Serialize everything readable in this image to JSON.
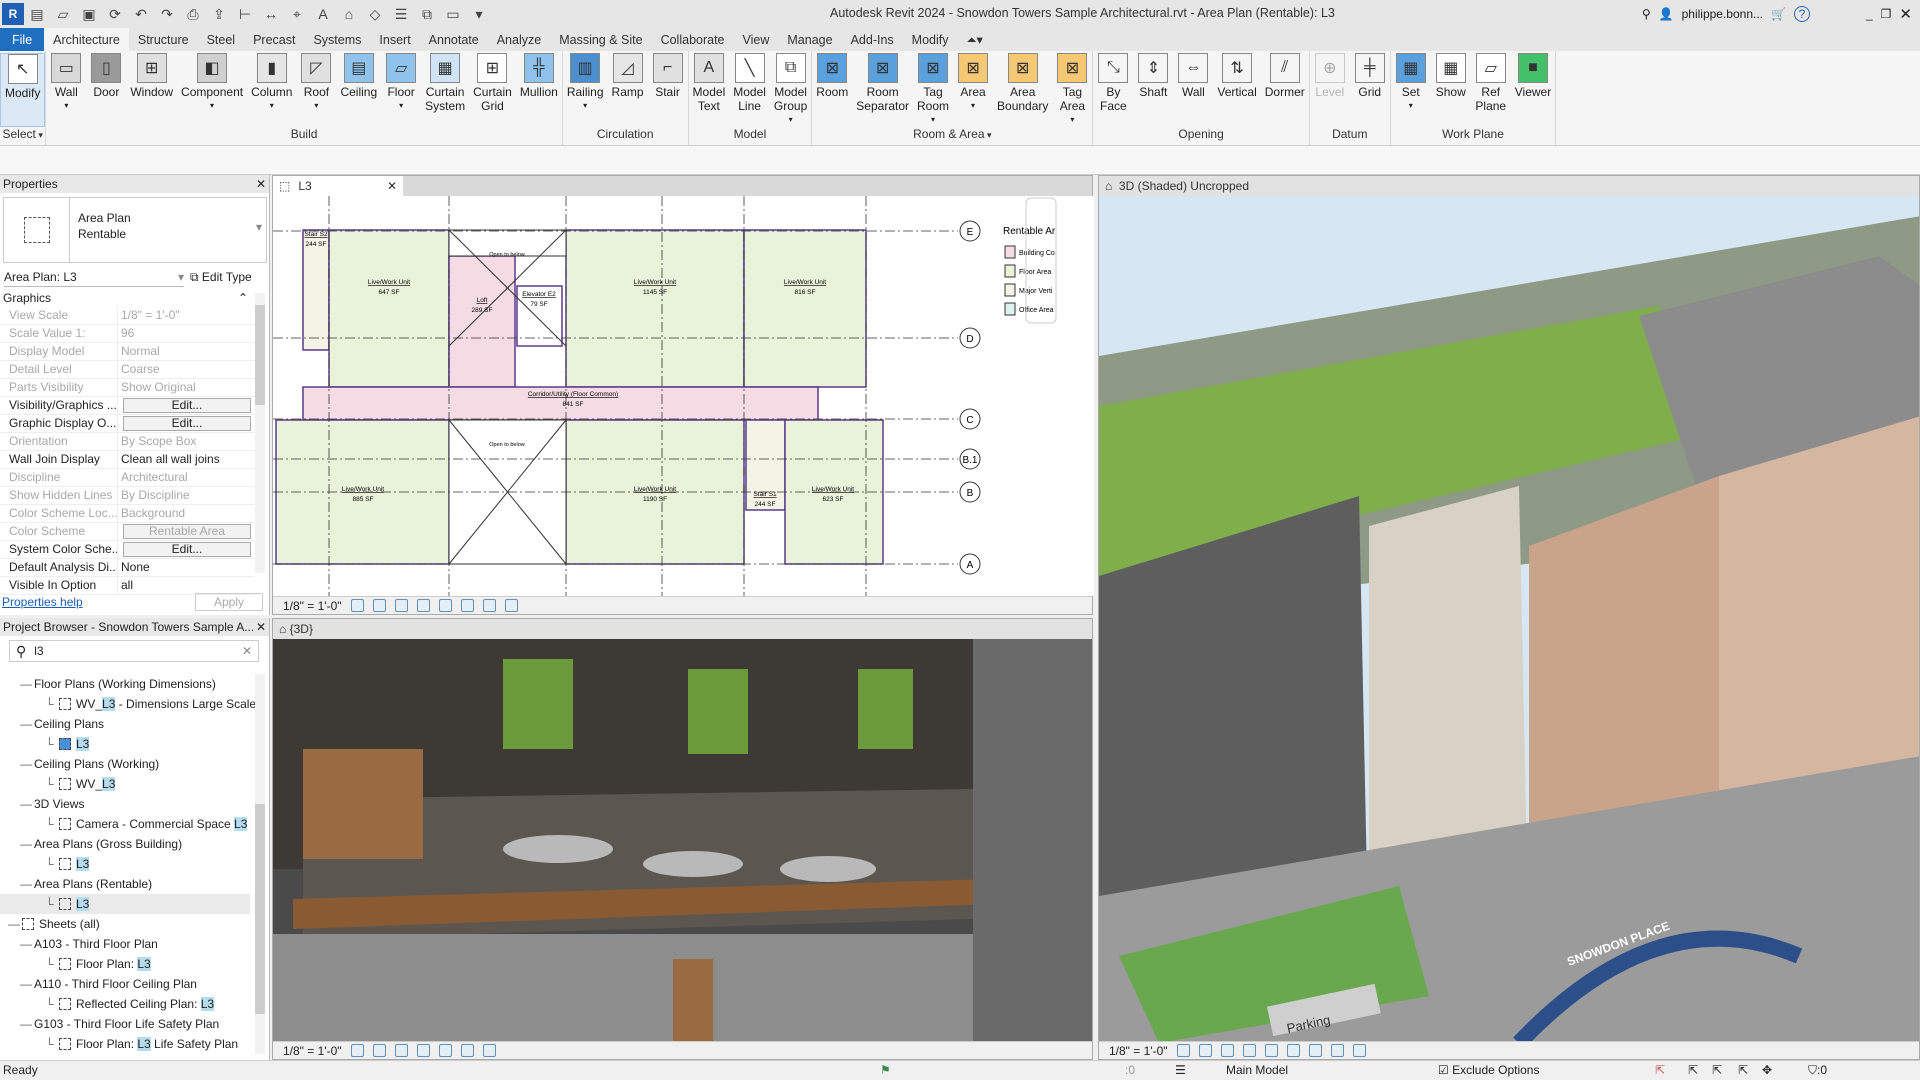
{
  "titlebar": {
    "app_icon": "R",
    "title": "Autodesk Revit 2024 - Snowdon Towers Sample Architectural.rvt - Area Plan (Rentable): L3",
    "user": "philippe.bonn...",
    "quick_access": [
      "app-menu-icon",
      "open-icon",
      "save-icon",
      "sync-icon",
      "undo-icon",
      "redo-icon",
      "print-icon",
      "export-icon",
      "measure-icon",
      "dimension-icon",
      "tag-icon",
      "text-icon",
      "home-3d-icon",
      "section-icon",
      "thin-lines-icon",
      "close-hidden-icon",
      "switch-windows-icon",
      "customize-icon"
    ]
  },
  "tabs": [
    "File",
    "Architecture",
    "Structure",
    "Steel",
    "Precast",
    "Systems",
    "Insert",
    "Annotate",
    "Analyze",
    "Massing & Site",
    "Collaborate",
    "View",
    "Manage",
    "Add-Ins",
    "Modify"
  ],
  "active_tab": "Architecture",
  "ribbon": {
    "panels": [
      {
        "label": "Select",
        "dropdown": true,
        "buttons": [
          {
            "label": "Modify",
            "icon": "cursor-icon",
            "glyph": "↖",
            "color": "#ffffff",
            "selected": true
          }
        ]
      },
      {
        "label": "Build",
        "buttons": [
          {
            "label": "Wall",
            "icon": "wall-icon",
            "glyph": "▭",
            "color": "#d8d8d8",
            "dropdown": true
          },
          {
            "label": "Door",
            "icon": "door-icon",
            "glyph": "▯",
            "color": "#9a9a9a"
          },
          {
            "label": "Window",
            "icon": "window-icon",
            "glyph": "⊞",
            "color": "#e0e0e0"
          },
          {
            "label": "Component",
            "icon": "component-icon",
            "glyph": "◧",
            "color": "#d0d0d0",
            "dropdown": true
          },
          {
            "label": "Column",
            "icon": "column-icon",
            "glyph": "▮",
            "color": "#e6e6e6",
            "dropdown": true
          },
          {
            "label": "Roof",
            "icon": "roof-icon",
            "glyph": "◸",
            "color": "#e0e0e0",
            "dropdown": true
          },
          {
            "label": "Ceiling",
            "icon": "ceiling-icon",
            "glyph": "▤",
            "color": "#8fc3ee"
          },
          {
            "label": "Floor",
            "icon": "floor-icon",
            "glyph": "▱",
            "color": "#8fc3ee",
            "dropdown": true
          },
          {
            "label": "Curtain",
            "label2": "System",
            "icon": "curtain-system-icon",
            "glyph": "▦",
            "color": "#cfe4f6"
          },
          {
            "label": "Curtain",
            "label2": "Grid",
            "icon": "curtain-grid-icon",
            "glyph": "⊞",
            "color": "#ffffff"
          },
          {
            "label": "Mullion",
            "icon": "mullion-icon",
            "glyph": "╬",
            "color": "#8fc3ee"
          }
        ]
      },
      {
        "label": "Circulation",
        "buttons": [
          {
            "label": "Railing",
            "icon": "railing-icon",
            "glyph": "▥",
            "color": "#4b8fd1",
            "dropdown": true
          },
          {
            "label": "Ramp",
            "icon": "ramp-icon",
            "glyph": "◿",
            "color": "#e6e6e6"
          },
          {
            "label": "Stair",
            "icon": "stair-icon",
            "glyph": "⌐",
            "color": "#e0e0e0"
          }
        ]
      },
      {
        "label": "Model",
        "buttons": [
          {
            "label": "Model",
            "label2": "Text",
            "icon": "model-text-icon",
            "glyph": "A",
            "color": "#e0e0e0"
          },
          {
            "label": "Model",
            "label2": "Line",
            "icon": "model-line-icon",
            "glyph": "╲",
            "color": "#ffffff"
          },
          {
            "label": "Model",
            "label2": "Group",
            "icon": "model-group-icon",
            "glyph": "⧉",
            "color": "#ffffff",
            "dropdown": true
          }
        ]
      },
      {
        "label": "Room & Area",
        "dropdown": true,
        "buttons": [
          {
            "label": "Room",
            "icon": "room-icon",
            "glyph": "⊠",
            "color": "#5aa0dc"
          },
          {
            "label": "Room",
            "label2": "Separator",
            "icon": "room-separator-icon",
            "glyph": "⊠",
            "color": "#5aa0dc"
          },
          {
            "label": "Tag",
            "label2": "Room",
            "icon": "tag-room-icon",
            "glyph": "⊠",
            "color": "#5aa0dc",
            "dropdown": true
          },
          {
            "label": "Area",
            "icon": "area-icon",
            "glyph": "⊠",
            "color": "#f7c873",
            "dropdown": true
          },
          {
            "label": "Area",
            "label2": "Boundary",
            "icon": "area-boundary-icon",
            "glyph": "⊠",
            "color": "#f7c873"
          },
          {
            "label": "Tag",
            "label2": "Area",
            "icon": "tag-area-icon",
            "glyph": "⊠",
            "color": "#f7c873",
            "dropdown": true
          }
        ]
      },
      {
        "label": "Opening",
        "buttons": [
          {
            "label": "By",
            "label2": "Face",
            "icon": "opening-by-face-icon",
            "glyph": "⤡",
            "color": "#f5f5f5"
          },
          {
            "label": "Shaft",
            "icon": "shaft-icon",
            "glyph": "⇕",
            "color": "#f5f5f5"
          },
          {
            "label": "Wall",
            "icon": "wall-opening-icon",
            "glyph": "⇔",
            "color": "#f5f5f5"
          },
          {
            "label": "Vertical",
            "icon": "vertical-opening-icon",
            "glyph": "⇅",
            "color": "#f5f5f5"
          },
          {
            "label": "Dormer",
            "icon": "dormer-icon",
            "glyph": "⫽",
            "color": "#f5f5f5"
          }
        ]
      },
      {
        "label": "Datum",
        "buttons": [
          {
            "label": "Level",
            "icon": "level-icon",
            "glyph": "⊕",
            "color": "#f5f5f5",
            "disabled": true
          },
          {
            "label": "Grid",
            "icon": "grid-icon",
            "glyph": "╪",
            "color": "#f5f5f5"
          }
        ]
      },
      {
        "label": "Work Plane",
        "buttons": [
          {
            "label": "Set",
            "icon": "set-work-plane-icon",
            "glyph": "▦",
            "color": "#5aa0dc",
            "dropdown": true
          },
          {
            "label": "Show",
            "icon": "show-work-plane-icon",
            "glyph": "▦",
            "color": "#ffffff"
          },
          {
            "label": "Ref",
            "label2": "Plane",
            "icon": "ref-plane-icon",
            "glyph": "▱",
            "color": "#ffffff"
          },
          {
            "label": "Viewer",
            "icon": "viewer-icon",
            "glyph": "■",
            "color": "#45c06a"
          }
        ]
      }
    ]
  },
  "properties": {
    "title": "Properties",
    "type_line1": "Area Plan",
    "type_line2": "Rentable",
    "instance": "Area Plan: L3",
    "edit_type": "Edit Type",
    "section": "Graphics",
    "rows": [
      {
        "name": "View Scale",
        "value": "1/8\" = 1'-0\"",
        "enabled": false
      },
      {
        "name": "Scale Value    1:",
        "value": "96",
        "enabled": false
      },
      {
        "name": "Display Model",
        "value": "Normal",
        "enabled": false
      },
      {
        "name": "Detail Level",
        "value": "Coarse",
        "enabled": false
      },
      {
        "name": "Parts Visibility",
        "value": "Show Original",
        "enabled": false
      },
      {
        "name": "Visibility/Graphics ...",
        "value": "Edit...",
        "enabled": true,
        "button": true
      },
      {
        "name": "Graphic Display O...",
        "value": "Edit...",
        "enabled": true,
        "button": true
      },
      {
        "name": "Orientation",
        "value": "By Scope Box",
        "enabled": false
      },
      {
        "name": "Wall Join Display",
        "value": "Clean all wall joins",
        "enabled": true
      },
      {
        "name": "Discipline",
        "value": "Architectural",
        "enabled": false
      },
      {
        "name": "Show Hidden Lines",
        "value": "By Discipline",
        "enabled": false
      },
      {
        "name": "Color Scheme Loc...",
        "value": "Background",
        "enabled": false
      },
      {
        "name": "Color Scheme",
        "value": "Rentable Area",
        "enabled": false,
        "button": true
      },
      {
        "name": "System Color Sche...",
        "value": "Edit...",
        "enabled": true,
        "button": true
      },
      {
        "name": "Default Analysis Di...",
        "value": "None",
        "enabled": true
      },
      {
        "name": "Visible In Option",
        "value": "all",
        "enabled": true
      }
    ],
    "help": "Properties help",
    "apply": "Apply"
  },
  "browser": {
    "title": "Project Browser - Snowdon Towers Sample A...",
    "search": "l3",
    "items": [
      {
        "level": 1,
        "pre": "Floor Plans (Working Dimensions)",
        "match": "",
        "post": "",
        "icon": "group"
      },
      {
        "level": 2,
        "pre": "WV_",
        "match": "L3",
        "post": " - Dimensions Large Scale",
        "icon": "view-plan-icon"
      },
      {
        "level": 1,
        "pre": "Ceiling Plans",
        "match": "",
        "post": "",
        "icon": "group"
      },
      {
        "level": 2,
        "pre": "",
        "match": "L3",
        "post": "",
        "icon": "view-ceiling-active-icon"
      },
      {
        "level": 1,
        "pre": "Ceiling Plans (Working)",
        "match": "",
        "post": "",
        "icon": "group"
      },
      {
        "level": 2,
        "pre": "WV_",
        "match": "L3",
        "post": "",
        "icon": "view-plan-icon"
      },
      {
        "level": 1,
        "pre": "3D Views",
        "match": "",
        "post": "",
        "icon": "group"
      },
      {
        "level": 2,
        "pre": "Camera - Commercial Space ",
        "match": "L3",
        "post": "",
        "icon": "view-plan-icon"
      },
      {
        "level": 1,
        "pre": "Area Plans (Gross Building)",
        "match": "",
        "post": "",
        "icon": "group"
      },
      {
        "level": 2,
        "pre": "",
        "match": "L3",
        "post": "",
        "icon": "view-plan-icon"
      },
      {
        "level": 1,
        "pre": "Area Plans (Rentable)",
        "match": "",
        "post": "",
        "icon": "group"
      },
      {
        "level": 2,
        "pre": "",
        "match": "L3",
        "post": "",
        "icon": "view-plan-icon",
        "selected": true
      },
      {
        "level": 0,
        "pre": "Sheets (all)",
        "match": "",
        "post": "",
        "icon": "sheet-icon"
      },
      {
        "level": 1,
        "pre": "A103 - Third Floor Plan",
        "match": "",
        "post": "",
        "icon": "group"
      },
      {
        "level": 2,
        "pre": "Floor Plan: ",
        "match": "L3",
        "post": "",
        "icon": "sheet-view-icon"
      },
      {
        "level": 1,
        "pre": "A110 - Third Floor Ceiling Plan",
        "match": "",
        "post": "",
        "icon": "group"
      },
      {
        "level": 2,
        "pre": "Reflected Ceiling Plan: ",
        "match": "L3",
        "post": "",
        "icon": "sheet-rcp-icon"
      },
      {
        "level": 1,
        "pre": "G103 - Third Floor Life Safety Plan",
        "match": "",
        "post": "",
        "icon": "group"
      },
      {
        "level": 2,
        "pre": "Floor Plan: ",
        "match": "L3",
        "post": " Life Safety Plan",
        "icon": "sheet-view-icon"
      }
    ]
  },
  "plan_view": {
    "tab": "L3",
    "scale": "1/8\" = 1'-0\"",
    "rooms": [
      {
        "name": "Stair S2",
        "area": "244 SF",
        "fill": "#f3f4e6"
      },
      {
        "name": "Live/Work Unit",
        "area": "647 SF",
        "fill": "#e8f3da"
      },
      {
        "name": "Loft",
        "area": "289 SF",
        "fill": "#f5dbe3"
      },
      {
        "name": "Elevator E2",
        "area": "79 SF",
        "fill": "#ffffff"
      },
      {
        "name": "Live/Work Unit",
        "area": "1145 SF",
        "fill": "#e8f3da"
      },
      {
        "name": "Live/Work Unit",
        "area": "816 SF",
        "fill": "#e8f3da"
      },
      {
        "name": "Corridor/Utility (Floor Common)",
        "area": "841 SF",
        "fill": "#f5dbe3"
      },
      {
        "name": "Live/Work Unit",
        "area": "885 SF",
        "fill": "#e8f3da"
      },
      {
        "name": "Live/Work Unit",
        "area": "1190 SF",
        "fill": "#e8f3da"
      },
      {
        "name": "Stair S1",
        "area": "244 SF",
        "fill": "#f3f4e6"
      },
      {
        "name": "Live/Work Unit",
        "area": "623 SF",
        "fill": "#e8f3da"
      }
    ],
    "open_to_below": "Open to below",
    "grids": [
      "E",
      "D",
      "C",
      "B.1",
      "B",
      "A"
    ],
    "legend_title": "Rentable Ar",
    "legend": [
      {
        "label": "Building Co",
        "color": "#f5dbe3"
      },
      {
        "label": "Floor Area",
        "color": "#e8f3da"
      },
      {
        "label": "Major Verti",
        "color": "#f3f4e6"
      },
      {
        "label": "Office Area",
        "color": "#dff2f2"
      }
    ]
  },
  "camera_view": {
    "tab": "{3D}",
    "scale": "1/8\" = 1'-0\""
  },
  "view3d": {
    "tab": "3D (Shaded) Uncropped",
    "scale": "1/8\" = 1'-0\"",
    "street_sign": "SNOWDON PLACE",
    "parking_sign": "Parking"
  },
  "status": {
    "ready": "Ready",
    "workset_count": ":0",
    "model": "Main Model",
    "exclude_options": "Exclude Options",
    "exclude_checked": true,
    "filter_count": ":0"
  },
  "colors": {
    "accent": "#1f6fc1",
    "area_floor": "#e8f3da",
    "area_common": "#f5dbe3",
    "boundary": "#5b3a8a"
  }
}
